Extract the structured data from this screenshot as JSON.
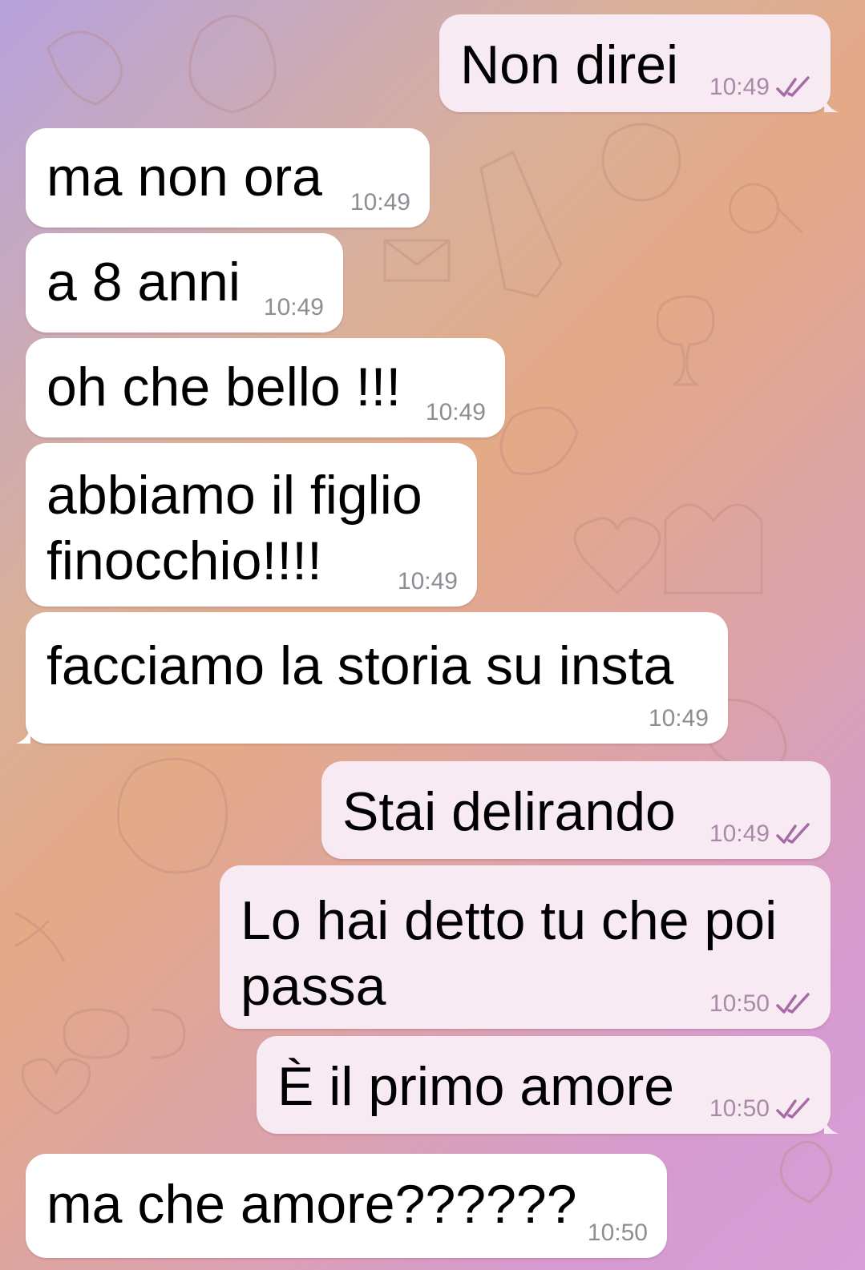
{
  "colors": {
    "incoming_bubble": "#ffffff",
    "outgoing_bubble": "#f7eaf2",
    "timestamp_in": "#8d8d93",
    "timestamp_out": "#a88aa7",
    "read_checks": "#a66aa7"
  },
  "icons": {
    "read_status": "double-check-icon"
  },
  "messages": [
    {
      "direction": "out",
      "text": "Non direi",
      "time": "10:49",
      "status": "read"
    },
    {
      "direction": "in",
      "text": "ma non ora",
      "time": "10:49"
    },
    {
      "direction": "in",
      "text": "a 8 anni",
      "time": "10:49"
    },
    {
      "direction": "in",
      "text": "oh che bello !!!",
      "time": "10:49"
    },
    {
      "direction": "in",
      "text": "abbiamo il figlio",
      "text2": "finocchio!!!!",
      "time": "10:49"
    },
    {
      "direction": "in",
      "text": "facciamo la storia su insta",
      "time": "10:49"
    },
    {
      "direction": "out",
      "text": "Stai delirando",
      "time": "10:49",
      "status": "read"
    },
    {
      "direction": "out",
      "text": "Lo hai detto tu che poi",
      "text2": "passa",
      "time": "10:50",
      "status": "read"
    },
    {
      "direction": "out",
      "text": "È il primo amore",
      "time": "10:50",
      "status": "read"
    },
    {
      "direction": "in",
      "text": "ma che amore??????",
      "time": "10:50"
    }
  ]
}
